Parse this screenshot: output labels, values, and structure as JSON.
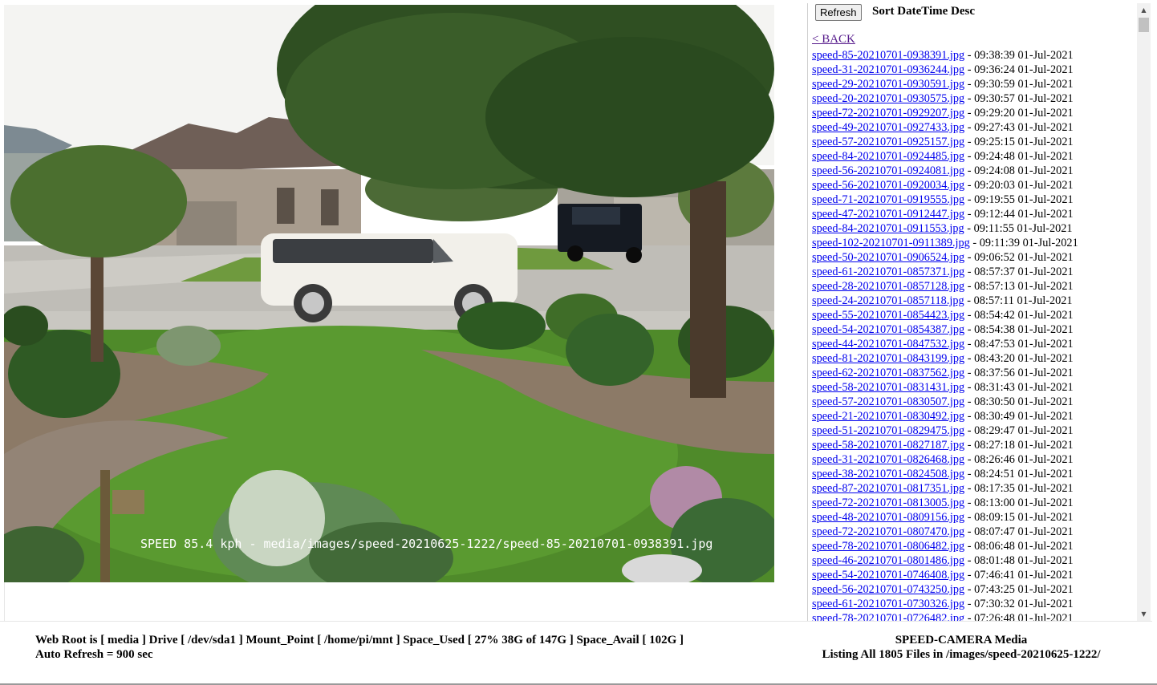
{
  "image": {
    "overlay_text": "SPEED 85.4 kph - media/images/speed-20210625-1222/speed-85-20210701-0938391.jpg"
  },
  "toolbar": {
    "refresh_label": "Refresh",
    "sort_label": "Sort DateTime Desc"
  },
  "nav": {
    "back_label": "< BACK"
  },
  "files": [
    {
      "name": "speed-85-20210701-0938391.jpg",
      "datetime": "- 09:38:39 01-Jul-2021"
    },
    {
      "name": "speed-31-20210701-0936244.jpg",
      "datetime": "- 09:36:24 01-Jul-2021"
    },
    {
      "name": "speed-29-20210701-0930591.jpg",
      "datetime": "- 09:30:59 01-Jul-2021"
    },
    {
      "name": "speed-20-20210701-0930575.jpg",
      "datetime": "- 09:30:57 01-Jul-2021"
    },
    {
      "name": "speed-72-20210701-0929207.jpg",
      "datetime": "- 09:29:20 01-Jul-2021"
    },
    {
      "name": "speed-49-20210701-0927433.jpg",
      "datetime": "- 09:27:43 01-Jul-2021"
    },
    {
      "name": "speed-57-20210701-0925157.jpg",
      "datetime": "- 09:25:15 01-Jul-2021"
    },
    {
      "name": "speed-84-20210701-0924485.jpg",
      "datetime": "- 09:24:48 01-Jul-2021"
    },
    {
      "name": "speed-56-20210701-0924081.jpg",
      "datetime": "- 09:24:08 01-Jul-2021"
    },
    {
      "name": "speed-56-20210701-0920034.jpg",
      "datetime": "- 09:20:03 01-Jul-2021"
    },
    {
      "name": "speed-71-20210701-0919555.jpg",
      "datetime": "- 09:19:55 01-Jul-2021"
    },
    {
      "name": "speed-47-20210701-0912447.jpg",
      "datetime": "- 09:12:44 01-Jul-2021"
    },
    {
      "name": "speed-84-20210701-0911553.jpg",
      "datetime": "- 09:11:55 01-Jul-2021"
    },
    {
      "name": "speed-102-20210701-0911389.jpg",
      "datetime": "- 09:11:39 01-Jul-2021"
    },
    {
      "name": "speed-50-20210701-0906524.jpg",
      "datetime": "- 09:06:52 01-Jul-2021"
    },
    {
      "name": "speed-61-20210701-0857371.jpg",
      "datetime": "- 08:57:37 01-Jul-2021"
    },
    {
      "name": "speed-28-20210701-0857128.jpg",
      "datetime": "- 08:57:13 01-Jul-2021"
    },
    {
      "name": "speed-24-20210701-0857118.jpg",
      "datetime": "- 08:57:11 01-Jul-2021"
    },
    {
      "name": "speed-55-20210701-0854423.jpg",
      "datetime": "- 08:54:42 01-Jul-2021"
    },
    {
      "name": "speed-54-20210701-0854387.jpg",
      "datetime": "- 08:54:38 01-Jul-2021"
    },
    {
      "name": "speed-44-20210701-0847532.jpg",
      "datetime": "- 08:47:53 01-Jul-2021"
    },
    {
      "name": "speed-81-20210701-0843199.jpg",
      "datetime": "- 08:43:20 01-Jul-2021"
    },
    {
      "name": "speed-62-20210701-0837562.jpg",
      "datetime": "- 08:37:56 01-Jul-2021"
    },
    {
      "name": "speed-58-20210701-0831431.jpg",
      "datetime": "- 08:31:43 01-Jul-2021"
    },
    {
      "name": "speed-57-20210701-0830507.jpg",
      "datetime": "- 08:30:50 01-Jul-2021"
    },
    {
      "name": "speed-21-20210701-0830492.jpg",
      "datetime": "- 08:30:49 01-Jul-2021"
    },
    {
      "name": "speed-51-20210701-0829475.jpg",
      "datetime": "- 08:29:47 01-Jul-2021"
    },
    {
      "name": "speed-58-20210701-0827187.jpg",
      "datetime": "- 08:27:18 01-Jul-2021"
    },
    {
      "name": "speed-31-20210701-0826468.jpg",
      "datetime": "- 08:26:46 01-Jul-2021"
    },
    {
      "name": "speed-38-20210701-0824508.jpg",
      "datetime": "- 08:24:51 01-Jul-2021"
    },
    {
      "name": "speed-87-20210701-0817351.jpg",
      "datetime": "- 08:17:35 01-Jul-2021"
    },
    {
      "name": "speed-72-20210701-0813005.jpg",
      "datetime": "- 08:13:00 01-Jul-2021"
    },
    {
      "name": "speed-48-20210701-0809156.jpg",
      "datetime": "- 08:09:15 01-Jul-2021"
    },
    {
      "name": "speed-72-20210701-0807470.jpg",
      "datetime": "- 08:07:47 01-Jul-2021"
    },
    {
      "name": "speed-78-20210701-0806482.jpg",
      "datetime": "- 08:06:48 01-Jul-2021"
    },
    {
      "name": "speed-46-20210701-0801486.jpg",
      "datetime": "- 08:01:48 01-Jul-2021"
    },
    {
      "name": "speed-54-20210701-0746408.jpg",
      "datetime": "- 07:46:41 01-Jul-2021"
    },
    {
      "name": "speed-56-20210701-0743250.jpg",
      "datetime": "- 07:43:25 01-Jul-2021"
    },
    {
      "name": "speed-61-20210701-0730326.jpg",
      "datetime": "- 07:30:32 01-Jul-2021"
    },
    {
      "name": "speed-78-20210701-0726482.jpg",
      "datetime": "- 07:26:48 01-Jul-2021"
    }
  ],
  "footer": {
    "left_line1": "Web Root is [ media ] Drive [ /dev/sda1 ] Mount_Point [ /home/pi/mnt ] Space_Used [ 27% 38G of 147G ] Space_Avail [ 102G ]",
    "left_line2": "Auto Refresh = 900 sec",
    "right_line1": "SPEED-CAMERA Media",
    "right_line2": "Listing All 1805 Files in /images/speed-20210625-1222/"
  },
  "icons": {
    "scroll_up": "scroll-up-arrow-icon",
    "scroll_down": "scroll-down-arrow-icon"
  }
}
